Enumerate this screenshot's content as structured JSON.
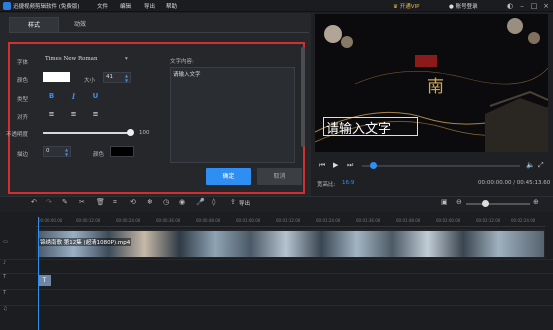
{
  "app": {
    "title": "迅捷视频剪辑软件 (免费版)"
  },
  "menu": [
    "文件",
    "编辑",
    "导出",
    "帮助"
  ],
  "header": {
    "vip": "开通VIP",
    "login": "账号登录"
  },
  "tabs": [
    {
      "label": "样式"
    },
    {
      "label": "动效"
    }
  ],
  "style": {
    "font_label": "字体",
    "font_value": "Times New Roman",
    "color_label": "颜色",
    "size_label": "大小",
    "size_value": "41",
    "type_label": "类型",
    "bold": "B",
    "italic": "I",
    "underline": "U",
    "align_label": "对齐",
    "opacity_label": "不透明度",
    "opacity_value": "100",
    "border_label": "描边",
    "border_value": "0",
    "border_color_label": "颜色",
    "text_content_label": "文字内容:",
    "text_content_value": "请输入文字",
    "ok": "确定",
    "cancel": "取消",
    "colors": {
      "font_color": "#ffffff",
      "border_color": "#000000",
      "accent": "#2f8ef1"
    }
  },
  "preview": {
    "overlay_text": "请输入文字",
    "aspect_label": "宽高比:",
    "aspect_value": "16:9",
    "time": "00:00:00.00 / 00:45:13.60",
    "progress": 0.0
  },
  "toolbar": {
    "export": "导出"
  },
  "timeline": {
    "ticks": [
      "00:00:00.00",
      "00:00:12.00",
      "00:00:24.00",
      "00:00:36.00",
      "00:00:48.00",
      "00:01:00.00",
      "00:01:12.00",
      "00:01:24.00",
      "00:01:36.00",
      "00:01:48.00",
      "00:02:00.00",
      "00:02:12.00",
      "00:02:24.00"
    ],
    "clip_label": "锦绣南歌 第12集 (超清1080P).mp4",
    "text_clip": "T"
  }
}
